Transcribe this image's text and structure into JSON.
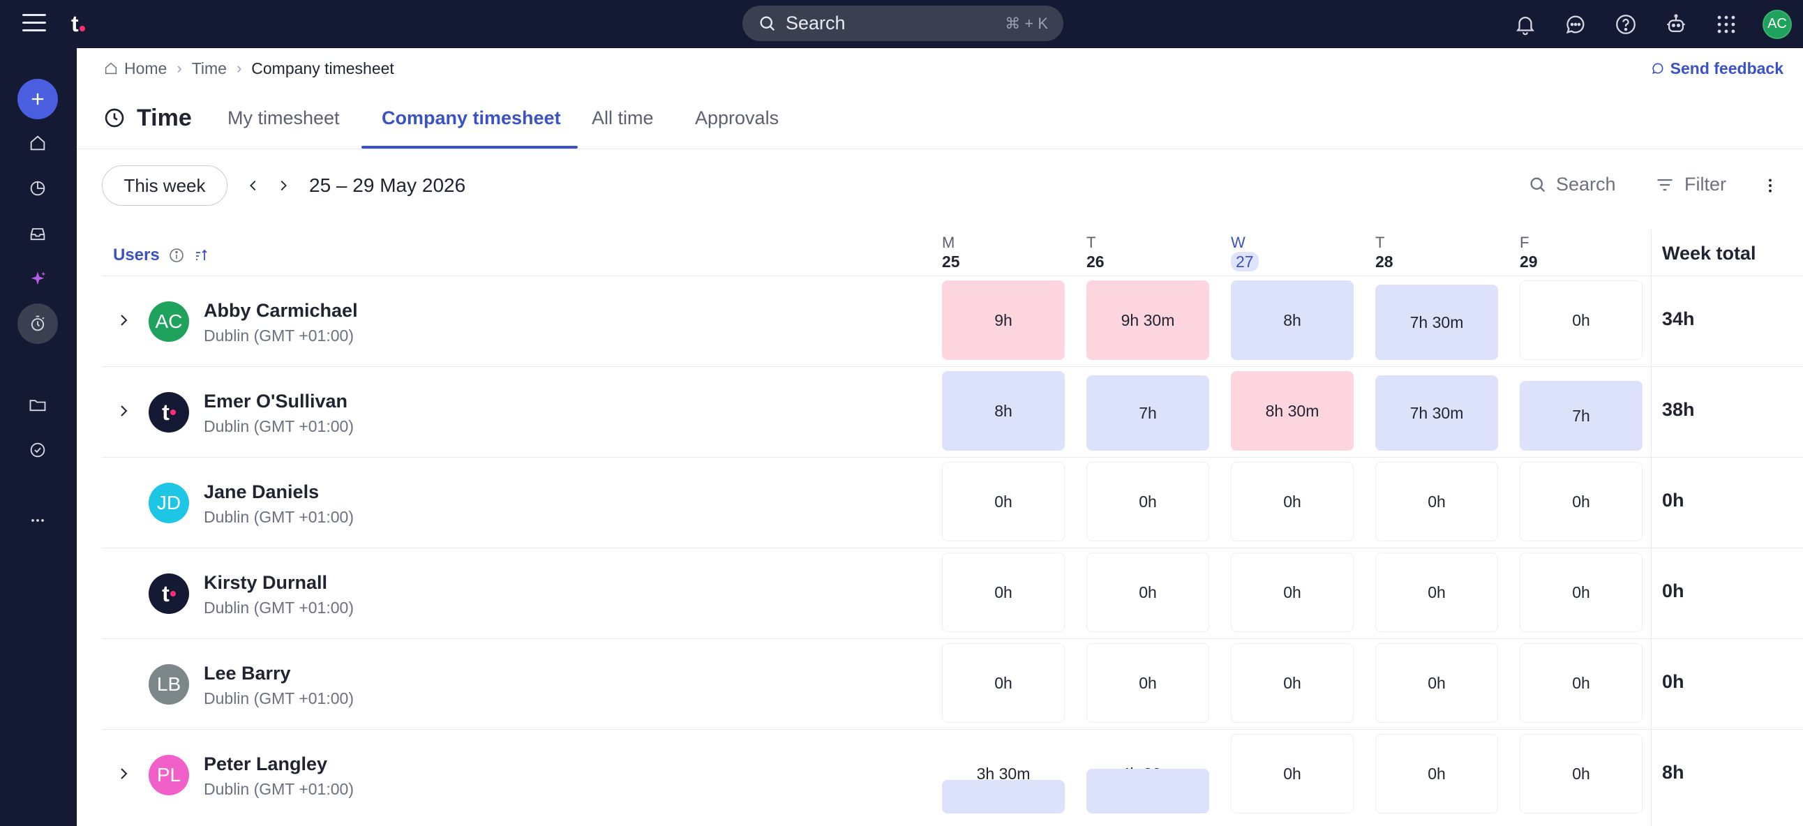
{
  "topbar": {
    "search_label": "Search",
    "search_shortcut": "⌘ + K",
    "user_initials": "AC"
  },
  "breadcrumb": {
    "items": [
      "Home",
      "Time",
      "Company timesheet"
    ]
  },
  "feedback_label": "Send feedback",
  "page_title": "Time",
  "tabs": [
    {
      "label": "My timesheet",
      "active": false
    },
    {
      "label": "Company timesheet",
      "active": true
    },
    {
      "label": "All time",
      "active": false
    },
    {
      "label": "Approvals",
      "active": false
    }
  ],
  "toolbar": {
    "this_week": "This week",
    "date_range": "25 – 29 May 2026",
    "search": "Search",
    "filter": "Filter"
  },
  "grid": {
    "users_label": "Users",
    "week_total_label": "Week total",
    "days": [
      {
        "letter": "M",
        "num": "25",
        "today": false
      },
      {
        "letter": "T",
        "num": "26",
        "today": false
      },
      {
        "letter": "W",
        "num": "27",
        "today": true
      },
      {
        "letter": "T",
        "num": "28",
        "today": false
      },
      {
        "letter": "F",
        "num": "29",
        "today": false
      }
    ],
    "rows": [
      {
        "name": "Abby Carmichael",
        "tz": "Dublin (GMT +01:00)",
        "initials": "AC",
        "avatar_color": "#1fa35c",
        "expandable": true,
        "cells": [
          {
            "v": "9h",
            "s": "pink"
          },
          {
            "v": "9h 30m",
            "s": "pink"
          },
          {
            "v": "8h",
            "s": "blue"
          },
          {
            "v": "7h 30m",
            "s": "blue"
          },
          {
            "v": "0h",
            "s": "empty"
          }
        ],
        "total": "34h"
      },
      {
        "name": "Emer O'Sullivan",
        "tz": "Dublin (GMT +01:00)",
        "initials": "t",
        "avatar_color": "#141a33",
        "expandable": true,
        "cells": [
          {
            "v": "8h",
            "s": "blue"
          },
          {
            "v": "7h",
            "s": "blue"
          },
          {
            "v": "8h 30m",
            "s": "pink"
          },
          {
            "v": "7h 30m",
            "s": "blue"
          },
          {
            "v": "7h",
            "s": "blue"
          }
        ],
        "total": "38h"
      },
      {
        "name": "Jane Daniels",
        "tz": "Dublin (GMT +01:00)",
        "initials": "JD",
        "avatar_color": "#1ec6e6",
        "expandable": false,
        "cells": [
          {
            "v": "0h",
            "s": "empty"
          },
          {
            "v": "0h",
            "s": "empty"
          },
          {
            "v": "0h",
            "s": "empty"
          },
          {
            "v": "0h",
            "s": "empty"
          },
          {
            "v": "0h",
            "s": "empty"
          }
        ],
        "total": "0h"
      },
      {
        "name": "Kirsty Durnall",
        "tz": "Dublin (GMT +01:00)",
        "initials": "t",
        "avatar_color": "#141a33",
        "expandable": false,
        "cells": [
          {
            "v": "0h",
            "s": "empty"
          },
          {
            "v": "0h",
            "s": "empty"
          },
          {
            "v": "0h",
            "s": "empty"
          },
          {
            "v": "0h",
            "s": "empty"
          },
          {
            "v": "0h",
            "s": "empty"
          }
        ],
        "total": "0h"
      },
      {
        "name": "Lee Barry",
        "tz": "Dublin (GMT +01:00)",
        "initials": "LB",
        "avatar_color": "#7c8789",
        "expandable": false,
        "cells": [
          {
            "v": "0h",
            "s": "empty"
          },
          {
            "v": "0h",
            "s": "empty"
          },
          {
            "v": "0h",
            "s": "empty"
          },
          {
            "v": "0h",
            "s": "empty"
          },
          {
            "v": "0h",
            "s": "empty"
          }
        ],
        "total": "0h"
      },
      {
        "name": "Peter Langley",
        "tz": "Dublin (GMT +01:00)",
        "initials": "PL",
        "avatar_color": "#f060c8",
        "expandable": true,
        "cells": [
          {
            "v": "3h 30m",
            "s": "partial"
          },
          {
            "v": "4h 30m",
            "s": "partial"
          },
          {
            "v": "0h",
            "s": "empty"
          },
          {
            "v": "0h",
            "s": "empty"
          },
          {
            "v": "0h",
            "s": "empty"
          }
        ],
        "total": "8h"
      }
    ]
  },
  "colors": {
    "accent": "#3b52c4",
    "over": "#fdd5de",
    "logged": "#dde2fb",
    "topbar": "#141a33"
  }
}
